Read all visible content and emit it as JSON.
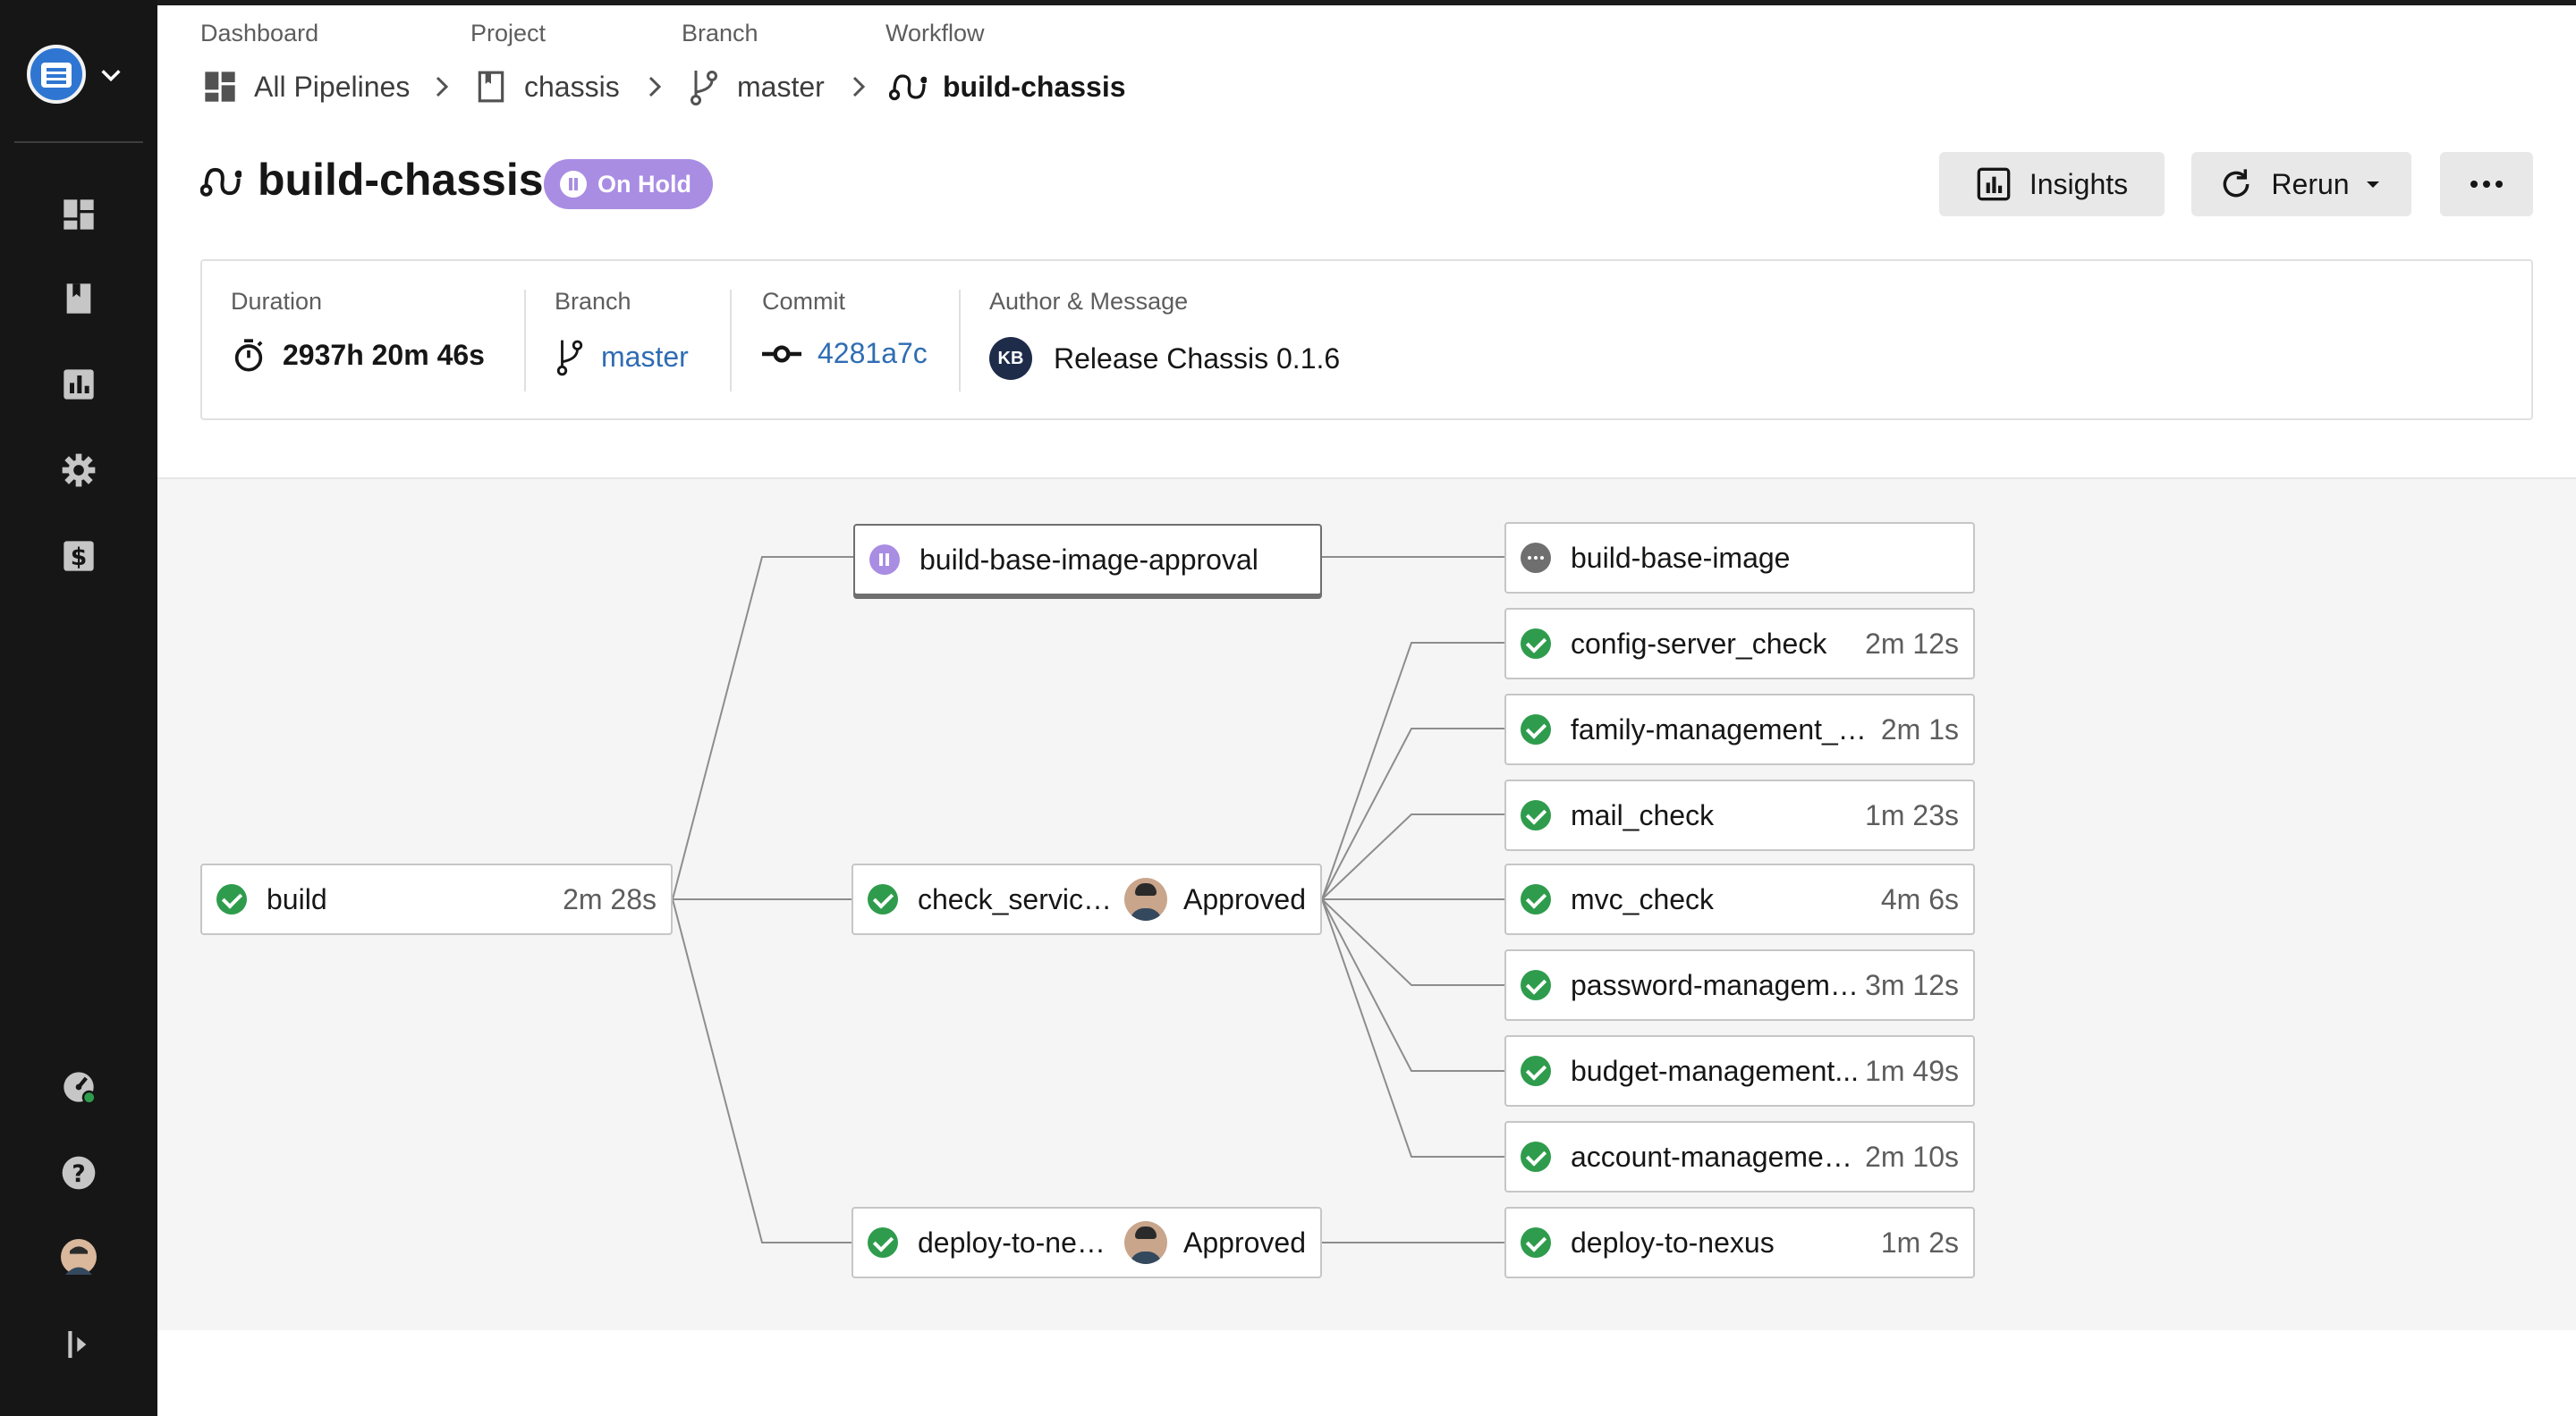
{
  "breadcrumbs": [
    {
      "label": "Dashboard",
      "value": "All Pipelines"
    },
    {
      "label": "Project",
      "value": "chassis"
    },
    {
      "label": "Branch",
      "value": "master"
    },
    {
      "label": "Workflow",
      "value": "build-chassis"
    }
  ],
  "workflow": {
    "title": "build-chassis",
    "status": "On Hold",
    "status_color": "#a98de3"
  },
  "actions": {
    "insights": "Insights",
    "rerun": "Rerun"
  },
  "info": {
    "duration_label": "Duration",
    "duration": "2937h 20m 46s",
    "branch_label": "Branch",
    "branch": "master",
    "commit_label": "Commit",
    "commit": "4281a7c",
    "author_label": "Author & Message",
    "author_initials": "KB",
    "message": "Release Chassis 0.1.6"
  },
  "jobs": {
    "build": {
      "name": "build",
      "duration": "2m 28s",
      "status": "success"
    },
    "approval_base": {
      "name": "build-base-image-approval",
      "status": "on-hold"
    },
    "check_services": {
      "name": "check_service...",
      "approval": "Approved",
      "status": "success"
    },
    "deploy_nexus_approval": {
      "name": "deploy-to-nex...",
      "approval": "Approved",
      "status": "success"
    },
    "build_base_image": {
      "name": "build-base-image",
      "status": "queued"
    },
    "config_server": {
      "name": "config-server_check",
      "duration": "2m 12s",
      "status": "success"
    },
    "family_mgmt": {
      "name": "family-management_c...",
      "duration": "2m 1s",
      "status": "success"
    },
    "mail": {
      "name": "mail_check",
      "duration": "1m 23s",
      "status": "success"
    },
    "mvc": {
      "name": "mvc_check",
      "duration": "4m 6s",
      "status": "success"
    },
    "password_mgmt": {
      "name": "password-manageme...",
      "duration": "3m 12s",
      "status": "success"
    },
    "budget_mgmt": {
      "name": "budget-management...",
      "duration": "1m 49s",
      "status": "success"
    },
    "account_mgmt": {
      "name": "account-managemen...",
      "duration": "2m 10s",
      "status": "success"
    },
    "deploy_nexus": {
      "name": "deploy-to-nexus",
      "duration": "1m 2s",
      "status": "success"
    }
  },
  "colors": {
    "sidebar": "#161616",
    "success": "#2e9c4c",
    "link": "#2f6db3",
    "canvas": "#f5f5f5"
  },
  "icons": [
    "logo-icon",
    "dashboard-icon",
    "projects-icon",
    "insights-icon",
    "settings-icon",
    "plans-icon",
    "status-icon",
    "help-icon",
    "user-avatar",
    "expand-sidebar-icon"
  ]
}
